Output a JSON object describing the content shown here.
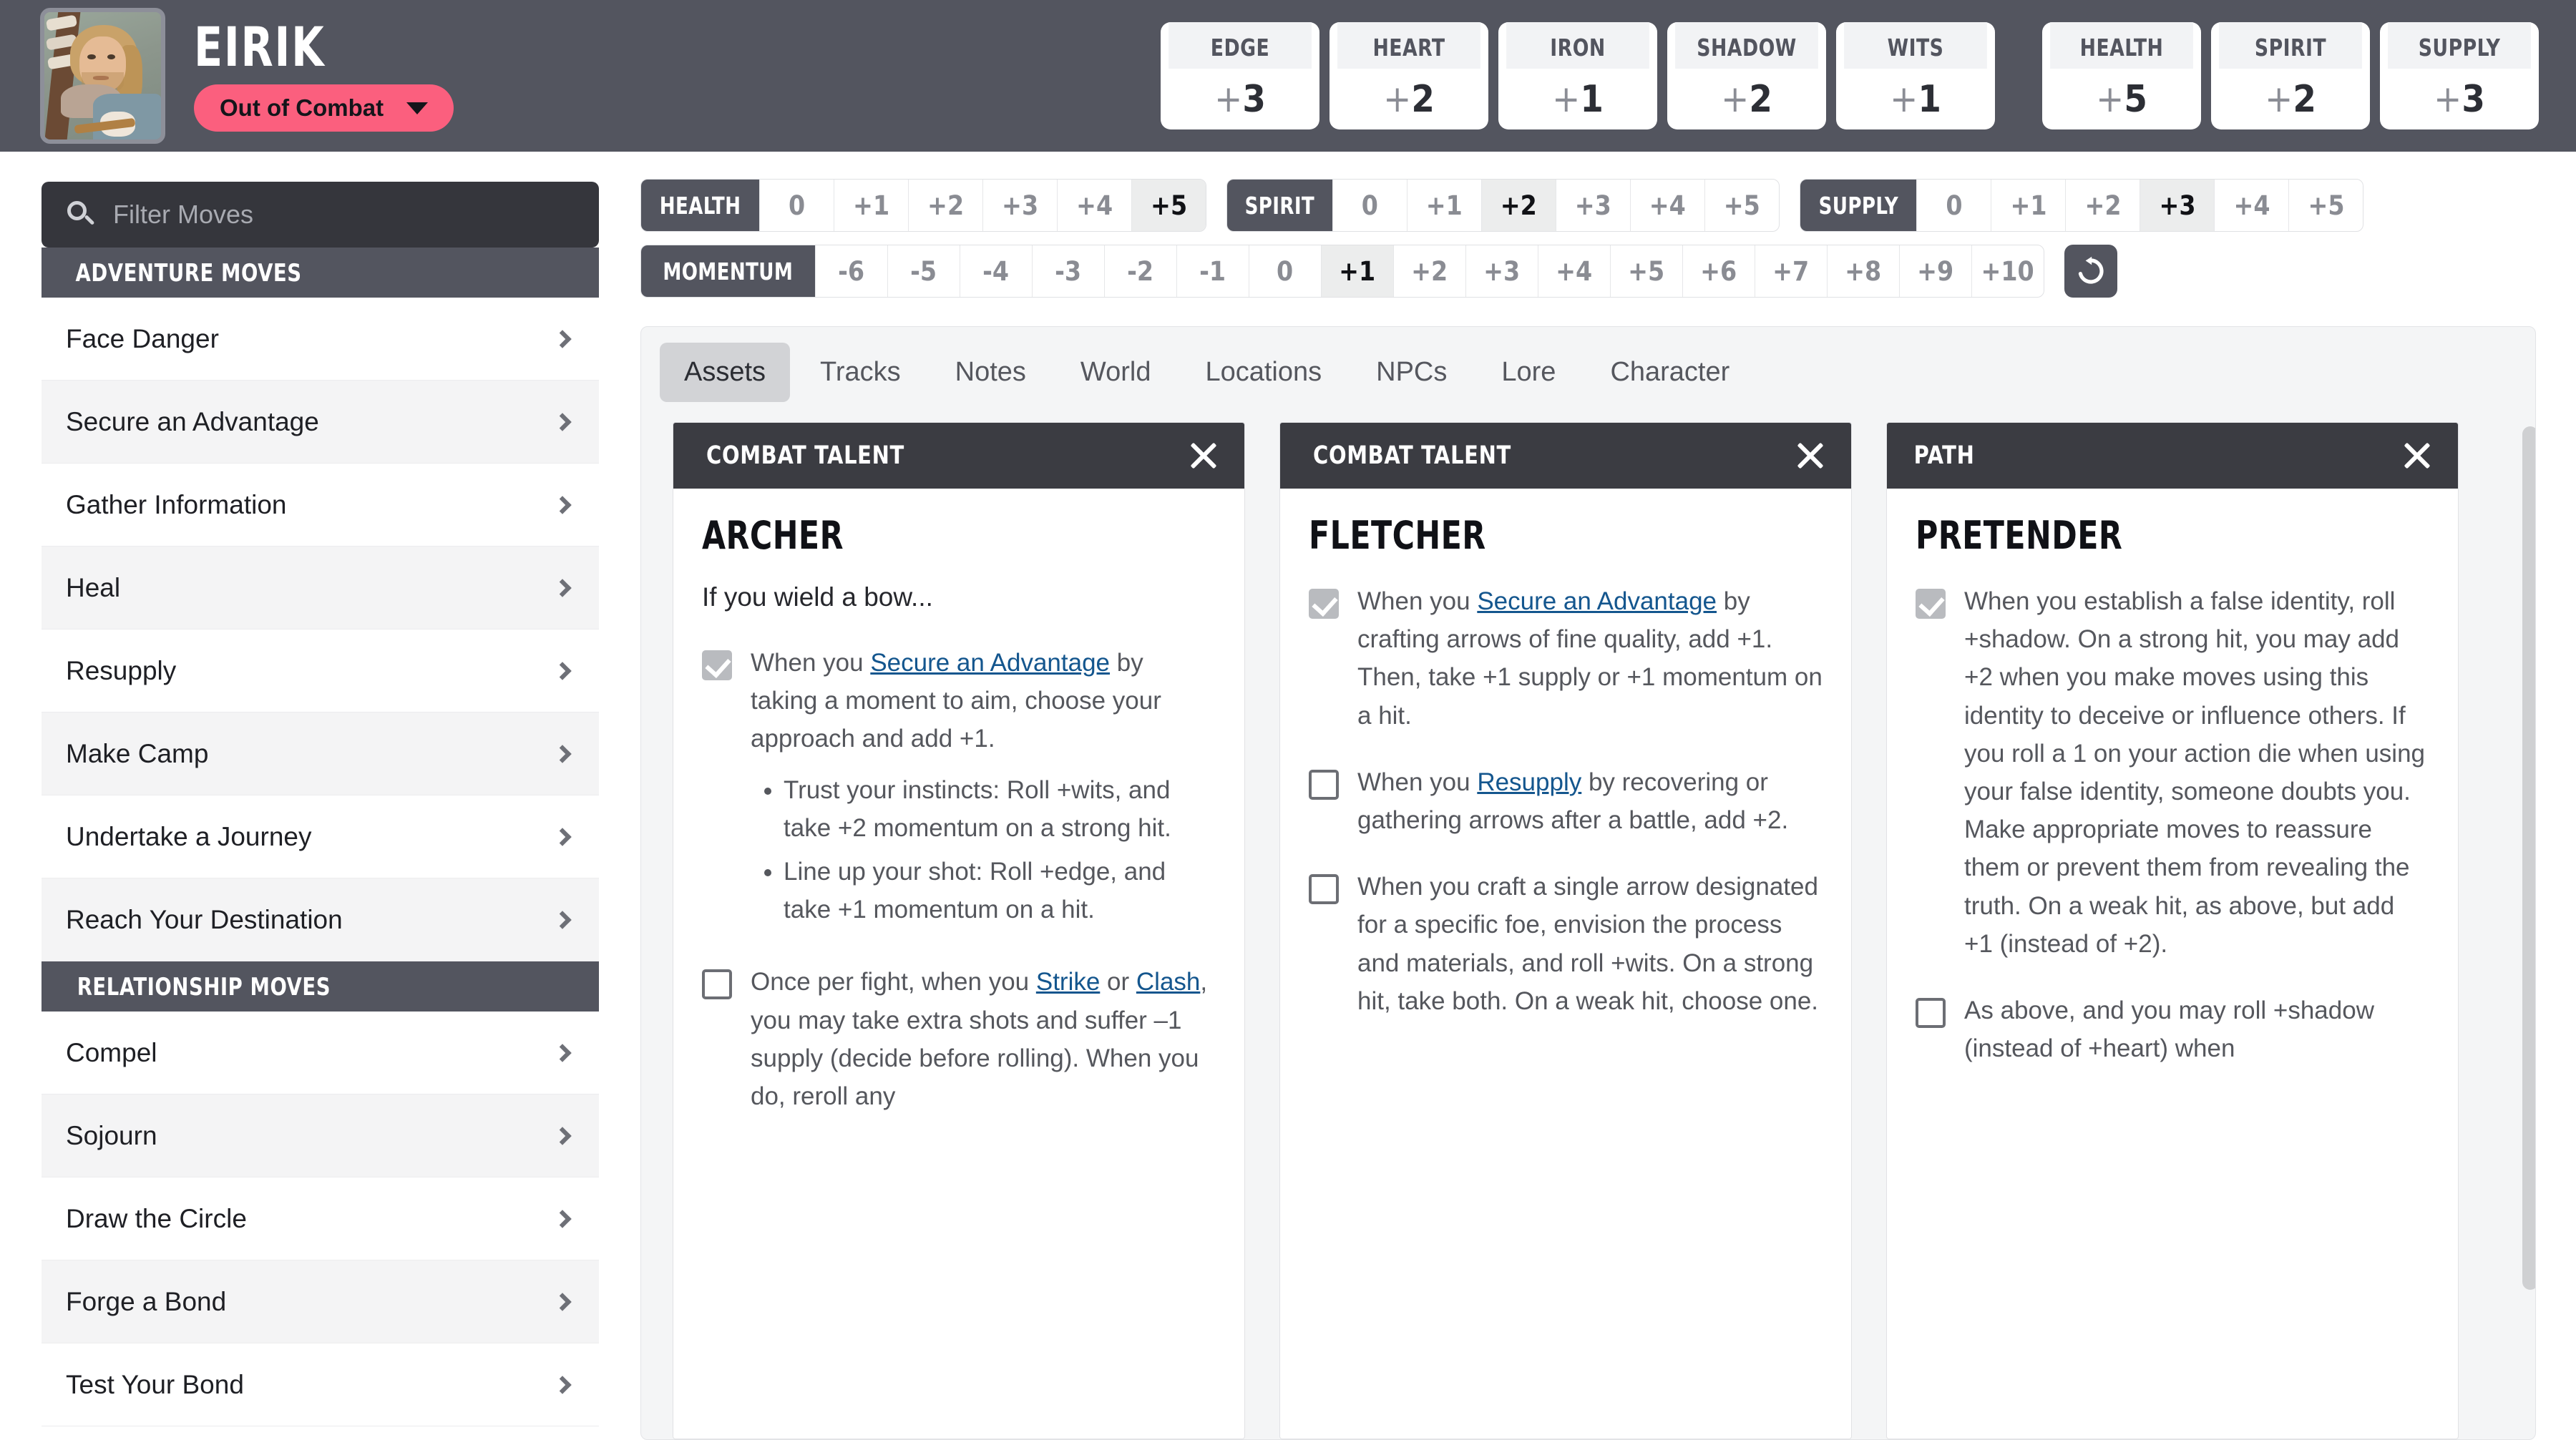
{
  "header": {
    "character_name": "EIRIK",
    "status_label": "Out of Combat",
    "status_color": "#fb5f7e",
    "avatar_name": "character-portrait",
    "stats": [
      {
        "label": "EDGE",
        "sign": "+",
        "value": "3"
      },
      {
        "label": "HEART",
        "sign": "+",
        "value": "2"
      },
      {
        "label": "IRON",
        "sign": "+",
        "value": "1"
      },
      {
        "label": "SHADOW",
        "sign": "+",
        "value": "2"
      },
      {
        "label": "WITS",
        "sign": "+",
        "value": "1"
      }
    ],
    "resources": [
      {
        "label": "HEALTH",
        "sign": "+",
        "value": "5"
      },
      {
        "label": "SPIRIT",
        "sign": "+",
        "value": "2"
      },
      {
        "label": "SUPPLY",
        "sign": "+",
        "value": "3"
      }
    ]
  },
  "tracks": [
    {
      "name": "HEALTH",
      "cells": [
        "0",
        "+1",
        "+2",
        "+3",
        "+4",
        "+5"
      ],
      "selected": "+5"
    },
    {
      "name": "SPIRIT",
      "cells": [
        "0",
        "+1",
        "+2",
        "+3",
        "+4",
        "+5"
      ],
      "selected": "+2"
    },
    {
      "name": "SUPPLY",
      "cells": [
        "0",
        "+1",
        "+2",
        "+3",
        "+4",
        "+5"
      ],
      "selected": "+3"
    },
    {
      "name": "MOMENTUM",
      "cells": [
        "-6",
        "-5",
        "-4",
        "-3",
        "-2",
        "-1",
        "0",
        "+1",
        "+2",
        "+3",
        "+4",
        "+5",
        "+6",
        "+7",
        "+8",
        "+9",
        "+10"
      ],
      "selected": "+1"
    }
  ],
  "momentum_reset_icon": "reset-arrow-icon",
  "sidebar": {
    "search_placeholder": "Filter Moves",
    "search_icon": "search-icon",
    "sections": [
      {
        "title": "ADVENTURE MOVES",
        "items": [
          "Face Danger",
          "Secure an Advantage",
          "Gather Information",
          "Heal",
          "Resupply",
          "Make Camp",
          "Undertake a Journey",
          "Reach Your Destination"
        ]
      },
      {
        "title": "RELATIONSHIP MOVES",
        "items": [
          "Compel",
          "Sojourn",
          "Draw the Circle",
          "Forge a Bond",
          "Test Your Bond"
        ]
      }
    ]
  },
  "panel": {
    "tabs": [
      "Assets",
      "Tracks",
      "Notes",
      "World",
      "Locations",
      "NPCs",
      "Lore",
      "Character"
    ],
    "active_tab": "Assets",
    "cards": [
      {
        "category": "COMBAT TALENT",
        "name": "ARCHER",
        "intro": "If you wield a bow...",
        "abilities": [
          {
            "checked": true,
            "pre": "When you ",
            "link": "Secure an Advantage",
            "post": " by taking a moment to aim, choose your approach and add +1.",
            "bullets": [
              "Trust your instincts: Roll +wits, and take +2 momentum on a strong hit.",
              "Line up your shot: Roll +edge, and take +1 momentum on a hit."
            ]
          },
          {
            "checked": false,
            "pre": "Once per fight, when you ",
            "link": "Strike",
            "mid": " or ",
            "link2": "Clash",
            "post": ", you may take extra shots and suffer –1 supply (decide before rolling). When you do, reroll any",
            "bullets": []
          }
        ]
      },
      {
        "category": "COMBAT TALENT",
        "name": "FLETCHER",
        "intro": "",
        "abilities": [
          {
            "checked": true,
            "pre": "When you ",
            "link": "Secure an Advantage",
            "post": " by crafting arrows of fine quality, add +1. Then, take +1 supply or +1 momentum on a hit.",
            "bullets": []
          },
          {
            "checked": false,
            "pre": "When you ",
            "link": "Resupply",
            "post": " by recovering or gathering arrows after a battle, add +2.",
            "bullets": []
          },
          {
            "checked": false,
            "pre": "When you craft a single arrow designated for a specific foe, envision the process and materials, and roll +wits. On a strong hit, take both. On a weak hit, choose one.",
            "link": "",
            "post": "",
            "bullets": []
          }
        ]
      },
      {
        "category": "PATH",
        "name": "PRETENDER",
        "intro": "",
        "abilities": [
          {
            "checked": true,
            "pre": "When you establish a false identity, roll +shadow. On a strong hit, you may add +2 when you make moves using this identity to deceive or influence others. If you roll a 1 on your action die when using your false identity, someone doubts you. Make appropriate moves to reassure them or prevent them from revealing the truth. On a weak hit, as above, but add +1 (instead of +2).",
            "link": "",
            "post": "",
            "bullets": []
          },
          {
            "checked": false,
            "pre": "As above, and you may roll +shadow (instead of +heart) when",
            "link": "",
            "post": "",
            "bullets": []
          }
        ]
      }
    ]
  }
}
